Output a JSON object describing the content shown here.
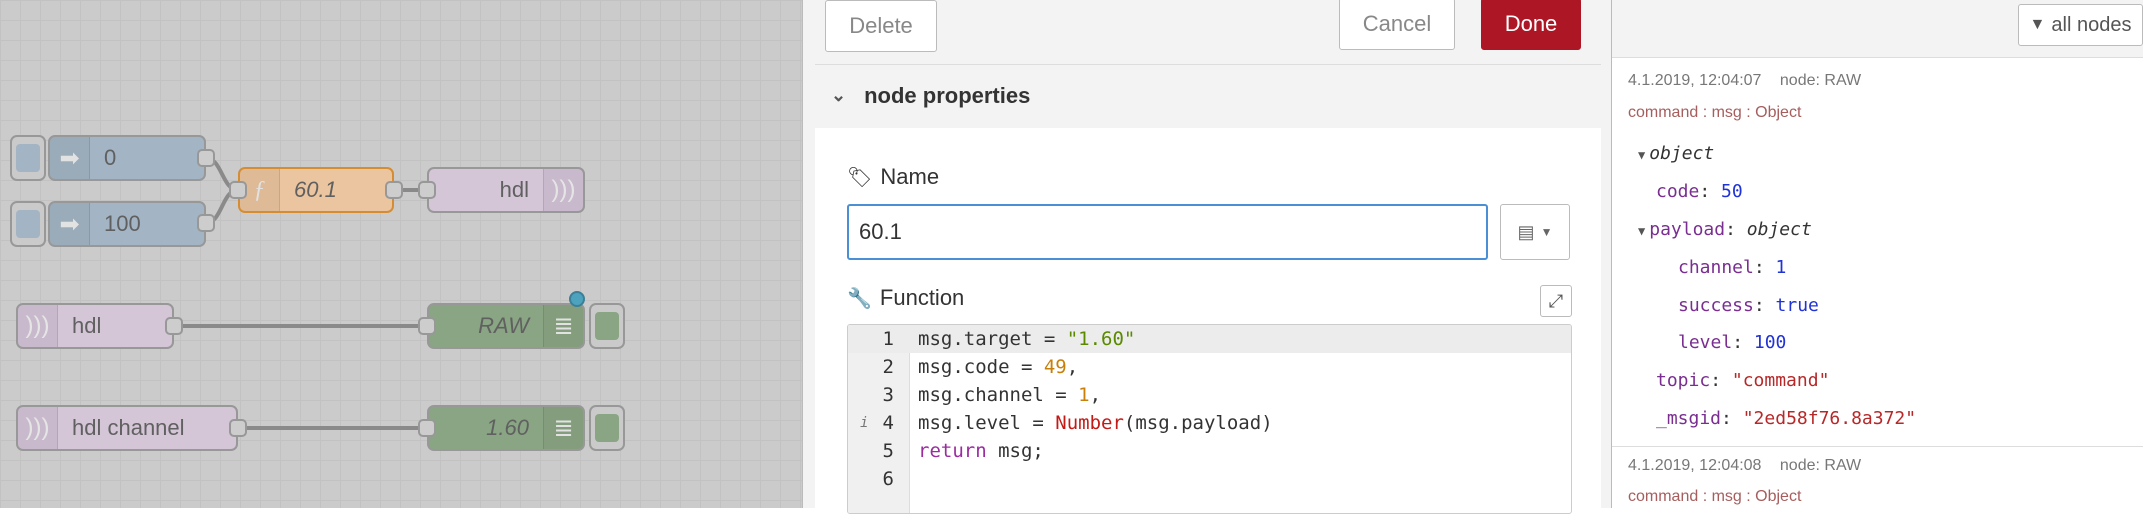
{
  "workspace": {
    "nodes": {
      "inject_0": {
        "label": "0"
      },
      "inject_100": {
        "label": "100"
      },
      "function_node": {
        "label": "60.1"
      },
      "hdl_out": {
        "label": "hdl"
      },
      "hdl_in": {
        "label": "hdl"
      },
      "debug_raw": {
        "label": "RAW"
      },
      "hdl_channel_in": {
        "label": "hdl channel"
      },
      "debug_160": {
        "label": "1.60"
      }
    },
    "colors": {
      "inject": "#a6bbcf",
      "function": "#fdd0a2",
      "hdl": "#e2d0e6",
      "debug": "#87a980",
      "wire": "#888888"
    }
  },
  "tray": {
    "delete_label": "Delete",
    "cancel_label": "Cancel",
    "done_label": "Done",
    "section_title": "node properties",
    "name_label": "Name",
    "name_value": "60.1",
    "function_label": "Function",
    "code_lines": [
      {
        "num": "1",
        "parts": [
          [
            "plain",
            "msg.target = "
          ],
          [
            "str",
            "\"1.60\""
          ]
        ]
      },
      {
        "num": "2",
        "parts": [
          [
            "plain",
            "msg.code = "
          ],
          [
            "num",
            "49"
          ],
          [
            "plain",
            ","
          ]
        ]
      },
      {
        "num": "3",
        "parts": [
          [
            "plain",
            "msg.channel = "
          ],
          [
            "num",
            "1"
          ],
          [
            "plain",
            ","
          ]
        ]
      },
      {
        "num": "4",
        "parts": [
          [
            "plain",
            "msg.level = "
          ],
          [
            "fn",
            "Number"
          ],
          [
            "plain",
            "(msg.payload)"
          ]
        ]
      },
      {
        "num": "5",
        "parts": [
          [
            "kw",
            "return"
          ],
          [
            "plain",
            " msg;"
          ]
        ]
      },
      {
        "num": "6",
        "parts": []
      }
    ],
    "colors": {
      "done": "#ad1625",
      "input_focus": "#4b8fd4"
    }
  },
  "sidebar": {
    "filter_label": "all nodes",
    "messages": [
      {
        "timestamp": "4.1.2019, 12:04:07",
        "node": "node: RAW",
        "topic_line": "command : msg : Object",
        "tree": {
          "root": "object",
          "code_key": "code",
          "code_val": "50",
          "payload_key": "payload",
          "payload_type": "object",
          "channel_key": "channel",
          "channel_val": "1",
          "success_key": "success",
          "success_val": "true",
          "level_key": "level",
          "level_val": "100",
          "topic_key": "topic",
          "topic_val": "\"command\"",
          "msgid_key": "_msgid",
          "msgid_val": "\"2ed58f76.8a372\""
        }
      },
      {
        "timestamp": "4.1.2019, 12:04:08",
        "node": "node: RAW",
        "topic_line": "command : msg : Object"
      }
    ]
  }
}
